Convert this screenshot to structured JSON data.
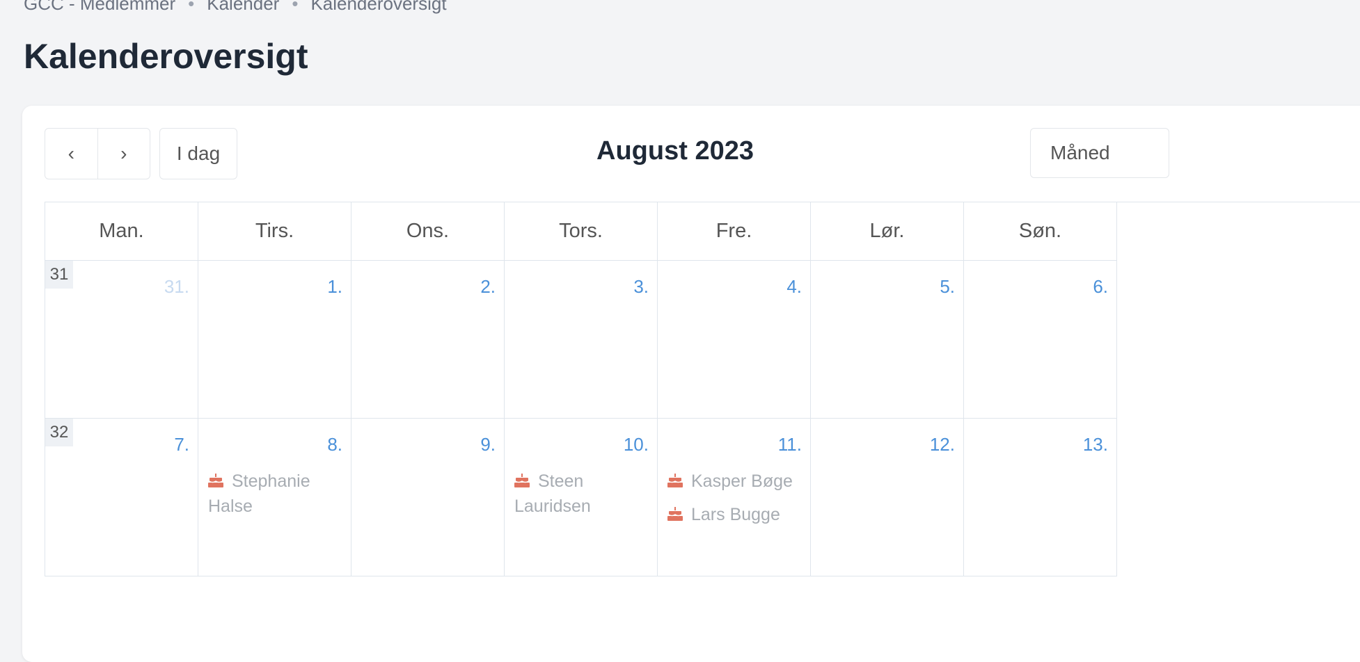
{
  "breadcrumb": [
    "GCC - Medlemmer",
    "Kalender",
    "Kalenderoversigt"
  ],
  "page_title": "Kalenderoversigt",
  "toolbar": {
    "prev_icon": "‹",
    "next_icon": "›",
    "today_label": "I dag",
    "month_title": "August 2023",
    "view_label": "Måned"
  },
  "weekdays": [
    "Man.",
    "Tirs.",
    "Ons.",
    "Tors.",
    "Fre.",
    "Lør.",
    "Søn."
  ],
  "weeks": [
    {
      "week_no": "31",
      "days": [
        {
          "num": "31.",
          "other": true,
          "events": []
        },
        {
          "num": "1.",
          "events": []
        },
        {
          "num": "2.",
          "events": []
        },
        {
          "num": "3.",
          "events": []
        },
        {
          "num": "4.",
          "events": []
        },
        {
          "num": "5.",
          "events": []
        },
        {
          "num": "6.",
          "events": []
        }
      ]
    },
    {
      "week_no": "32",
      "days": [
        {
          "num": "7.",
          "events": []
        },
        {
          "num": "8.",
          "events": [
            "Stephanie Halse"
          ]
        },
        {
          "num": "9.",
          "events": []
        },
        {
          "num": "10.",
          "events": [
            "Steen Lauridsen"
          ]
        },
        {
          "num": "11.",
          "events": [
            "Kasper Bøge",
            "Lars Bugge"
          ]
        },
        {
          "num": "12.",
          "events": []
        },
        {
          "num": "13.",
          "events": []
        }
      ]
    }
  ],
  "colors": {
    "accent": "#4a90d9",
    "birthday_icon": "#e0735f",
    "event_text": "#a7acb2"
  },
  "event_icon": "birthday-cake-icon"
}
